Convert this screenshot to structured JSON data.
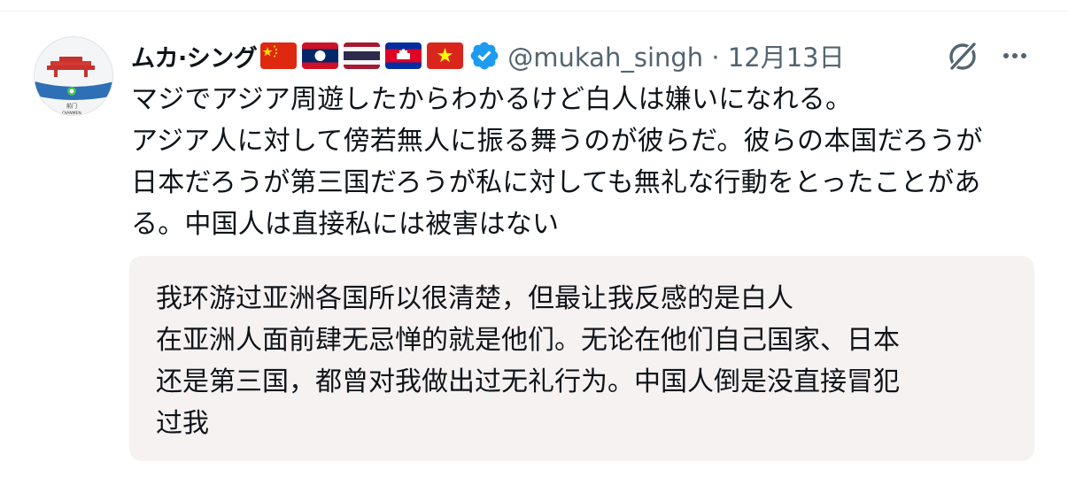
{
  "author": {
    "display_name": "ムカ·シング",
    "handle": "@mukah_singh",
    "separator": "·",
    "date": "12月13日",
    "avatar_caption": "前门",
    "avatar_sub_caption": "QIANMEN",
    "flags": [
      {
        "name": "china-flag-icon",
        "country": "China"
      },
      {
        "name": "laos-flag-icon",
        "country": "Laos"
      },
      {
        "name": "thailand-flag-icon",
        "country": "Thailand"
      },
      {
        "name": "cambodia-flag-icon",
        "country": "Cambodia"
      },
      {
        "name": "vietnam-flag-icon",
        "country": "Vietnam"
      }
    ],
    "verified_color": "#1d9bf0"
  },
  "tweet": {
    "text": "マジでアジア周遊したからわかるけど白人は嫌いになれる。\nアジア人に対して傍若無人に振る舞うのが彼らだ。彼らの本国だろうが\n日本だろうが第三国だろうが私に対しても無礼な行動をとったことがあ\nる。中国人は直接私には被害はない"
  },
  "translation": {
    "text": "我环游过亚洲各国所以很清楚，但最让我反感的是白人\n在亚洲人面前肆无忌惮的就是他们。无论在他们自己国家、日本\n还是第三国，都曾对我做出过无礼行为。中国人倒是没直接冒犯\n过我"
  },
  "icons": {
    "grok": "grok-icon",
    "more": "more-options-icon"
  },
  "colors": {
    "text": "#0f1419",
    "secondary": "#536471",
    "translation_bg": "#f7f2f2"
  }
}
